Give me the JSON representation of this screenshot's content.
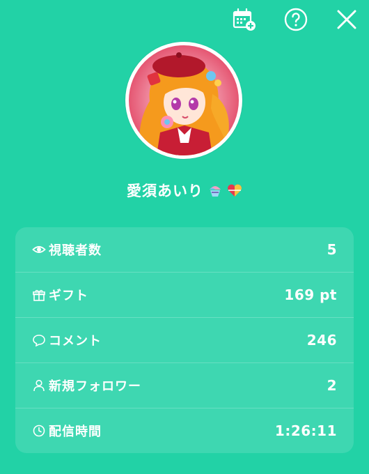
{
  "header": {
    "icons": {
      "calendar": "calendar-add-icon",
      "help": "help-icon",
      "close": "close-icon"
    }
  },
  "profile": {
    "name": "愛須あいり",
    "badges": [
      "shaved-ice-emoji",
      "heart-emoji"
    ]
  },
  "stats": {
    "viewers": {
      "label": "視聴者数",
      "value": "5",
      "icon": "eye-icon"
    },
    "gifts": {
      "label": "ギフト",
      "value": "169 pt",
      "icon": "gift-icon"
    },
    "comments": {
      "label": "コメント",
      "value": "246",
      "icon": "comment-icon"
    },
    "followers": {
      "label": "新規フォロワー",
      "value": "2",
      "icon": "user-icon"
    },
    "duration": {
      "label": "配信時間",
      "value": "1:26:11",
      "icon": "clock-icon"
    }
  },
  "colors": {
    "background": "#22d2a6",
    "text": "#ffffff",
    "card": "rgba(255,255,255,0.13)"
  }
}
